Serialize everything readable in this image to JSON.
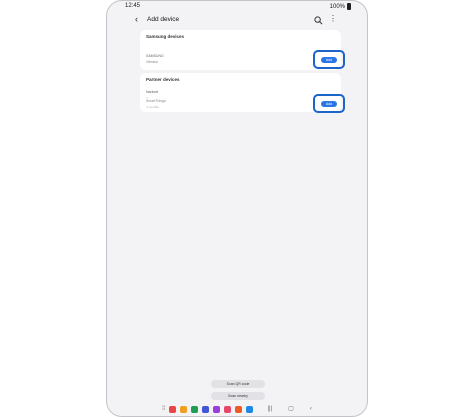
{
  "status_bar": {
    "time": "12:45",
    "battery": "100%"
  },
  "app_bar": {
    "title": "Add device"
  },
  "sections": {
    "samsung": {
      "header": "Samsung devices",
      "device_name": "SAMSUNG",
      "device_sub": "Vibrator",
      "add_label": "Add"
    },
    "partner": {
      "header": "Partner devices",
      "device_name": "Nanleaf",
      "device_model": "—",
      "device_sub": "SmartThings",
      "device_extra": "⚠ no info",
      "add_label": "Add"
    }
  },
  "actions": {
    "scan_qr": "Scan QR code",
    "scan_nearby": "Scan nearby"
  },
  "colors": {
    "accent": "#2a76e6",
    "highlight": "#1b64c8",
    "background": "#f3f3f6"
  },
  "taskbar": {
    "apps": [
      {
        "name": "app-1-icon",
        "color": "#e84545"
      },
      {
        "name": "app-2-icon",
        "color": "#f0a020"
      },
      {
        "name": "app-3-icon",
        "color": "#1f9d55"
      },
      {
        "name": "app-4-icon",
        "color": "#4355d6"
      },
      {
        "name": "app-5-icon",
        "color": "#9b3ddb"
      },
      {
        "name": "app-6-icon",
        "color": "#e8456b"
      },
      {
        "name": "app-7-icon",
        "color": "#ee5a24"
      },
      {
        "name": "app-8-icon",
        "color": "#1e88e5"
      }
    ]
  }
}
